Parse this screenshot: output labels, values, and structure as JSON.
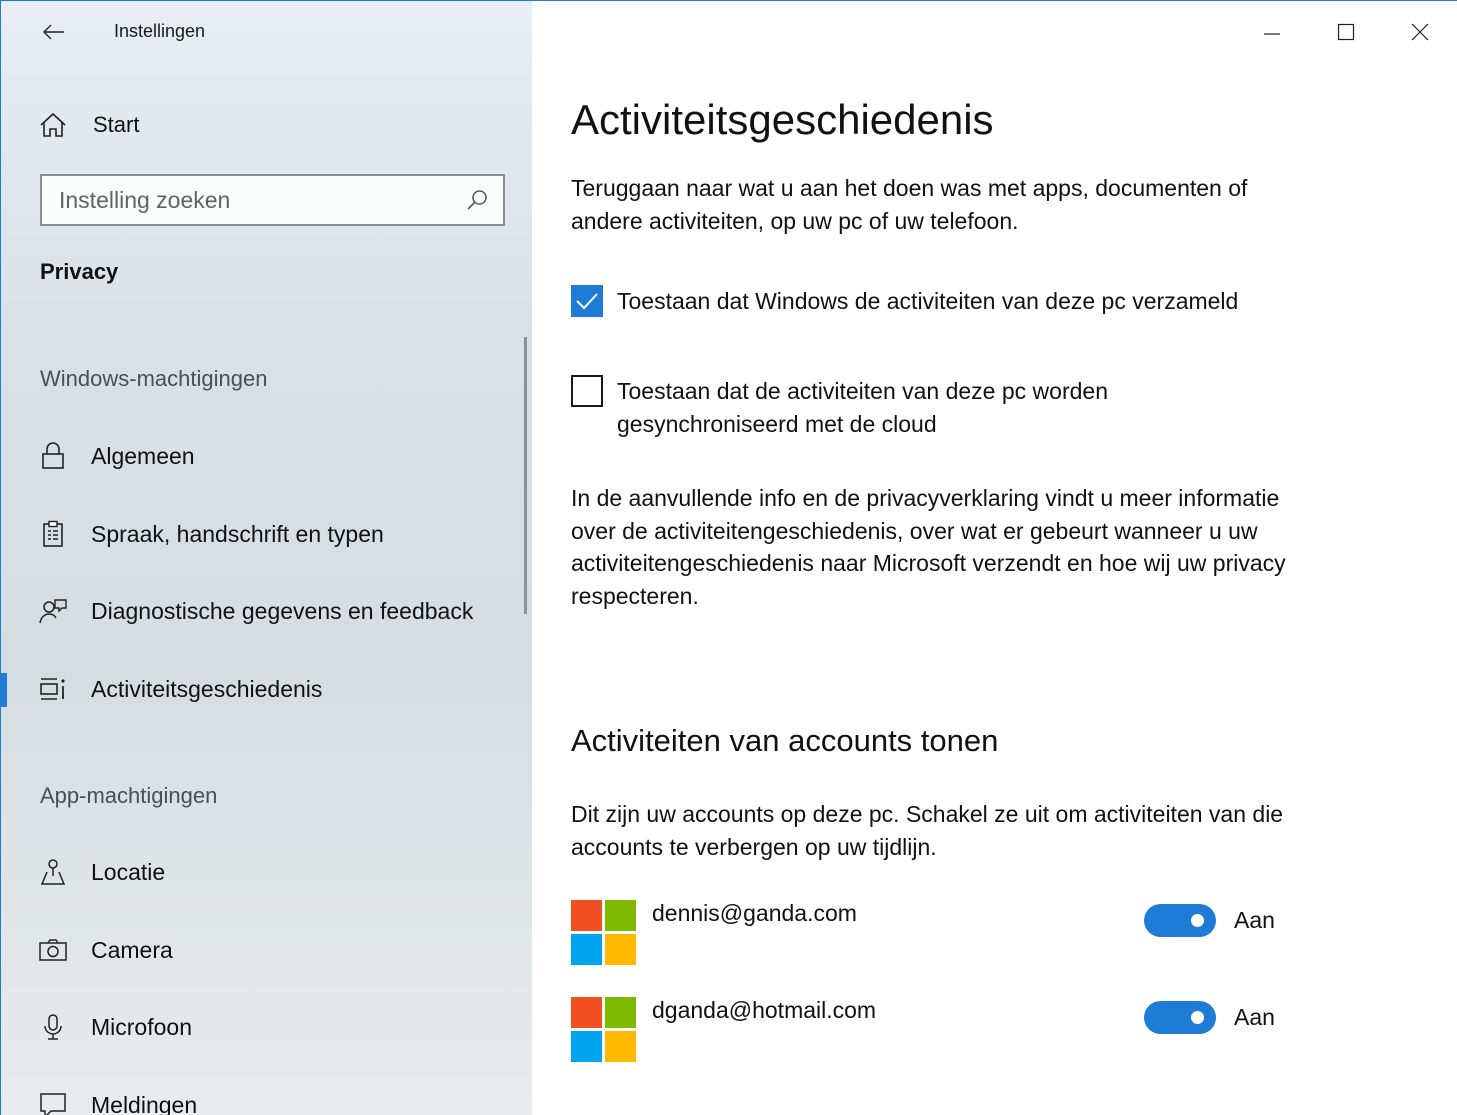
{
  "window": {
    "title": "Instellingen",
    "accent_color": "#1e7bd6"
  },
  "sidebar": {
    "home_label": "Start",
    "search": {
      "placeholder": "Instelling zoeken",
      "value": ""
    },
    "section_title": "Privacy",
    "groups": [
      {
        "heading": "Windows-machtigingen",
        "items": [
          {
            "label": "Algemeen",
            "icon": "lock-icon",
            "selected": false
          },
          {
            "label": "Spraak, handschrift en typen",
            "icon": "clipboard-icon",
            "selected": false
          },
          {
            "label": "Diagnostische gegevens en feedback",
            "icon": "feedback-icon",
            "selected": false
          },
          {
            "label": "Activiteitsgeschiedenis",
            "icon": "timeline-icon",
            "selected": true
          }
        ]
      },
      {
        "heading": "App-machtigingen",
        "items": [
          {
            "label": "Locatie",
            "icon": "location-icon",
            "selected": false
          },
          {
            "label": "Camera",
            "icon": "camera-icon",
            "selected": false
          },
          {
            "label": "Microfoon",
            "icon": "microphone-icon",
            "selected": false
          },
          {
            "label": "Meldingen",
            "icon": "notification-icon",
            "selected": false
          }
        ]
      }
    ]
  },
  "main": {
    "page_title": "Activiteitsgeschiedenis",
    "intro": "Teruggaan naar wat u aan het doen was met apps, documenten of andere activiteiten, op uw pc of uw telefoon.",
    "checkboxes": [
      {
        "label": "Toestaan dat Windows de activiteiten van deze pc verzameld",
        "checked": true
      },
      {
        "label": "Toestaan dat de activiteiten van deze pc worden gesynchroniseerd met de cloud",
        "checked": false
      }
    ],
    "info": "In de aanvullende info en de privacyverklaring vindt u meer informatie over de activiteitengeschiedenis, over wat er gebeurt wanneer u uw activiteitengeschiedenis naar Microsoft verzendt en hoe wij uw privacy respecteren.",
    "accounts_title": "Activiteiten van accounts tonen",
    "accounts_description": "Dit zijn uw accounts op deze pc. Schakel ze uit om activiteiten van die accounts te verbergen op uw tijdlijn.",
    "accounts": [
      {
        "email": "dennis@ganda.com",
        "toggle_on": true,
        "toggle_label": "Aan"
      },
      {
        "email": "dganda@hotmail.com",
        "toggle_on": true,
        "toggle_label": "Aan"
      }
    ],
    "ms_logo_colors": [
      "#f25022",
      "#7fba00",
      "#00a4ef",
      "#ffb900"
    ]
  }
}
